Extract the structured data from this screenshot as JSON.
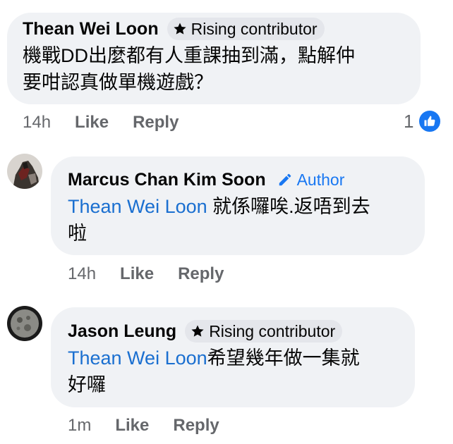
{
  "comments": [
    {
      "author": "Thean Wei Loon",
      "badge": "Rising contributor",
      "badge_icon": "star-icon",
      "text_lines": [
        "機戰DD出麼都有人重課抽到滿，點解仲",
        "要咁認真做單機遊戲？"
      ],
      "time": "14h",
      "like_label": "Like",
      "reply_label": "Reply",
      "reaction_count": "1",
      "reaction_icon": "thumbs-up-icon"
    },
    {
      "author": "Marcus Chan Kim Soon",
      "badge": "Author",
      "badge_icon": "pencil-icon",
      "mention": "Thean Wei Loon",
      "text_first": " 就係囉唉.返唔到去",
      "text_second": "啦",
      "time": "14h",
      "like_label": "Like",
      "reply_label": "Reply"
    },
    {
      "author": "Jason Leung",
      "badge": "Rising contributor",
      "badge_icon": "star-icon",
      "mention": "Thean Wei Loon",
      "text_first": "希望幾年做一集就",
      "text_second": "好囉",
      "time": "1m",
      "like_label": "Like",
      "reply_label": "Reply"
    }
  ],
  "colors": {
    "bubble": "#f0f2f5",
    "badge": "#e4e6eb",
    "mention": "#1a6fd0",
    "meta": "#65676b",
    "like_blue": "#1877f2"
  }
}
